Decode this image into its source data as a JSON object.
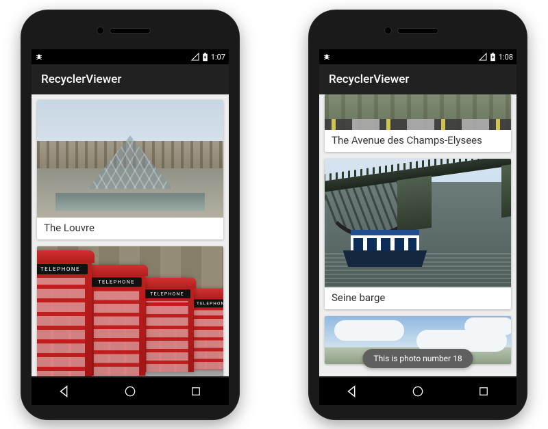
{
  "phones": [
    {
      "status": {
        "time": "1:07"
      },
      "app": {
        "title": "RecyclerViewer"
      },
      "scroll_offset": 0,
      "cards": [
        {
          "kind": "louvre",
          "caption": "The Louvre"
        },
        {
          "kind": "phonebox",
          "caption": ""
        }
      ],
      "toast": null
    },
    {
      "status": {
        "time": "1:08"
      },
      "app": {
        "title": "RecyclerViewer"
      },
      "scroll_offset": 0,
      "cards": [
        {
          "kind": "champs",
          "caption": "The Avenue des Champs-Elysees",
          "top_partial": true
        },
        {
          "kind": "seine",
          "caption": "Seine barge"
        },
        {
          "kind": "sky",
          "caption": "",
          "bottom_partial": true
        }
      ],
      "toast": "This is photo number 18"
    }
  ],
  "phonebox_sign": "TELEPHONE",
  "nav": {
    "back": "back-icon",
    "home": "home-icon",
    "recent": "recent-icon"
  }
}
